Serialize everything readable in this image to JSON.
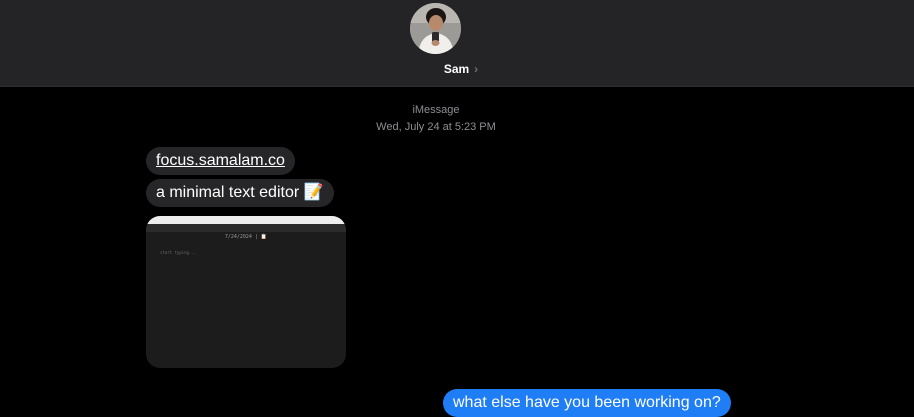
{
  "header": {
    "contact_name": "Sam",
    "chevron": "›"
  },
  "thread": {
    "service": "iMessage",
    "timestamp": "Wed, July 24 at 5:23 PM"
  },
  "messages": [
    {
      "direction": "incoming",
      "type": "link",
      "text": "focus.samalam.co"
    },
    {
      "direction": "incoming",
      "type": "text",
      "text": "a minimal text editor 📝"
    },
    {
      "direction": "incoming",
      "type": "image",
      "preview": {
        "date_text": "7/24/2024 | 📋",
        "placeholder": "start typing..."
      }
    },
    {
      "direction": "outgoing",
      "type": "text",
      "text": "what else have you been working on?"
    }
  ],
  "colors": {
    "outgoing_bubble": "#1f7ef5",
    "incoming_bubble": "#262628",
    "header_bg": "#242326",
    "background": "#000000"
  }
}
